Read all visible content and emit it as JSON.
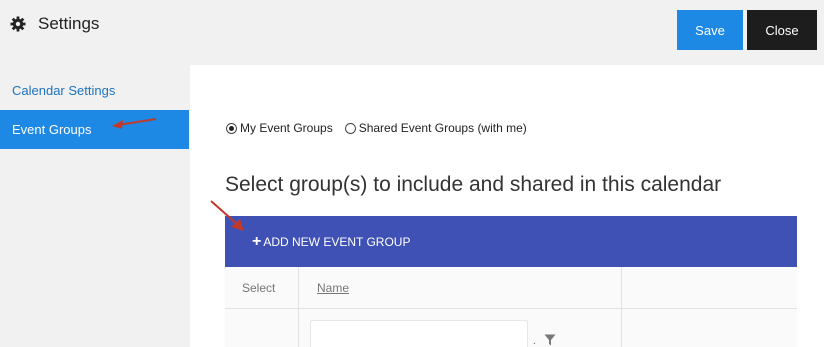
{
  "header": {
    "title": "Settings",
    "save_label": "Save",
    "close_label": "Close"
  },
  "sidebar": {
    "items": [
      {
        "label": "Calendar Settings"
      },
      {
        "label": "Event Groups"
      }
    ]
  },
  "main": {
    "radio_options": [
      {
        "label": "My Event Groups",
        "checked": true
      },
      {
        "label": "Shared Event Groups (with me)",
        "checked": false
      }
    ],
    "section_title": "Select group(s) to include and shared in this calendar",
    "add_group_label": "ADD NEW EVENT GROUP",
    "table": {
      "headers": [
        "Select",
        "Name"
      ]
    }
  },
  "colors": {
    "accent": "#1e88e5",
    "group_bar": "#3f51b5",
    "close_button": "#1d1d1d",
    "annotation_arrow": "#c0392b"
  }
}
